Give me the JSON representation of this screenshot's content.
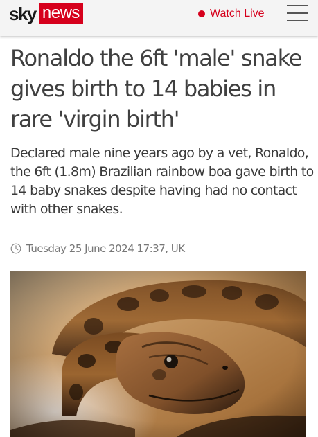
{
  "header": {
    "logo": {
      "brand": "sky",
      "product": "news"
    },
    "watch_live_label": "Watch Live",
    "menu_icon": "hamburger-menu-icon",
    "colors": {
      "brand_red": "#d6001c",
      "header_background": "#f4f4f4"
    }
  },
  "article": {
    "headline": "Ronaldo the 6ft 'male' snake gives birth to 14 babies in rare 'virgin birth'",
    "standfirst": "Declared male nine years ago by a vet, Ronaldo, the 6ft (1.8m) Brazilian rainbow boa gave birth to 14 baby snakes despite having had no contact with other snakes.",
    "published": "Tuesday 25 June 2024 17:37, UK",
    "date_icon": "clock-icon",
    "hero_image_icon": "snake-photo"
  }
}
